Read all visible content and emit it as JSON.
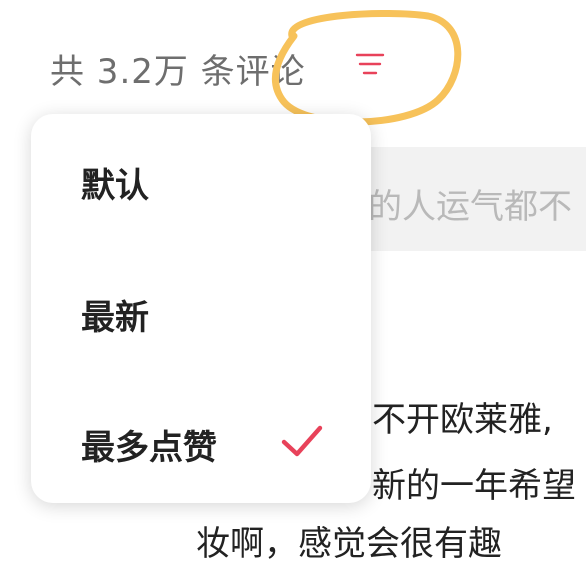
{
  "header": {
    "comment_count": "共 3.2万 条评论"
  },
  "background": {
    "input_preview": "的人运气都不",
    "lines": [
      "不开欧莱雅,",
      "新的一年希望",
      "妆啊，感觉会很有趣"
    ]
  },
  "sort_menu": {
    "items": [
      {
        "label": "默认"
      },
      {
        "label": "最新"
      },
      {
        "label": "最多点赞"
      }
    ],
    "selected_index": 2
  },
  "colors": {
    "accent": "#e8425a",
    "annotation": "#f7c25a"
  },
  "icons": {
    "filter": "filter-icon",
    "check": "check-icon"
  }
}
